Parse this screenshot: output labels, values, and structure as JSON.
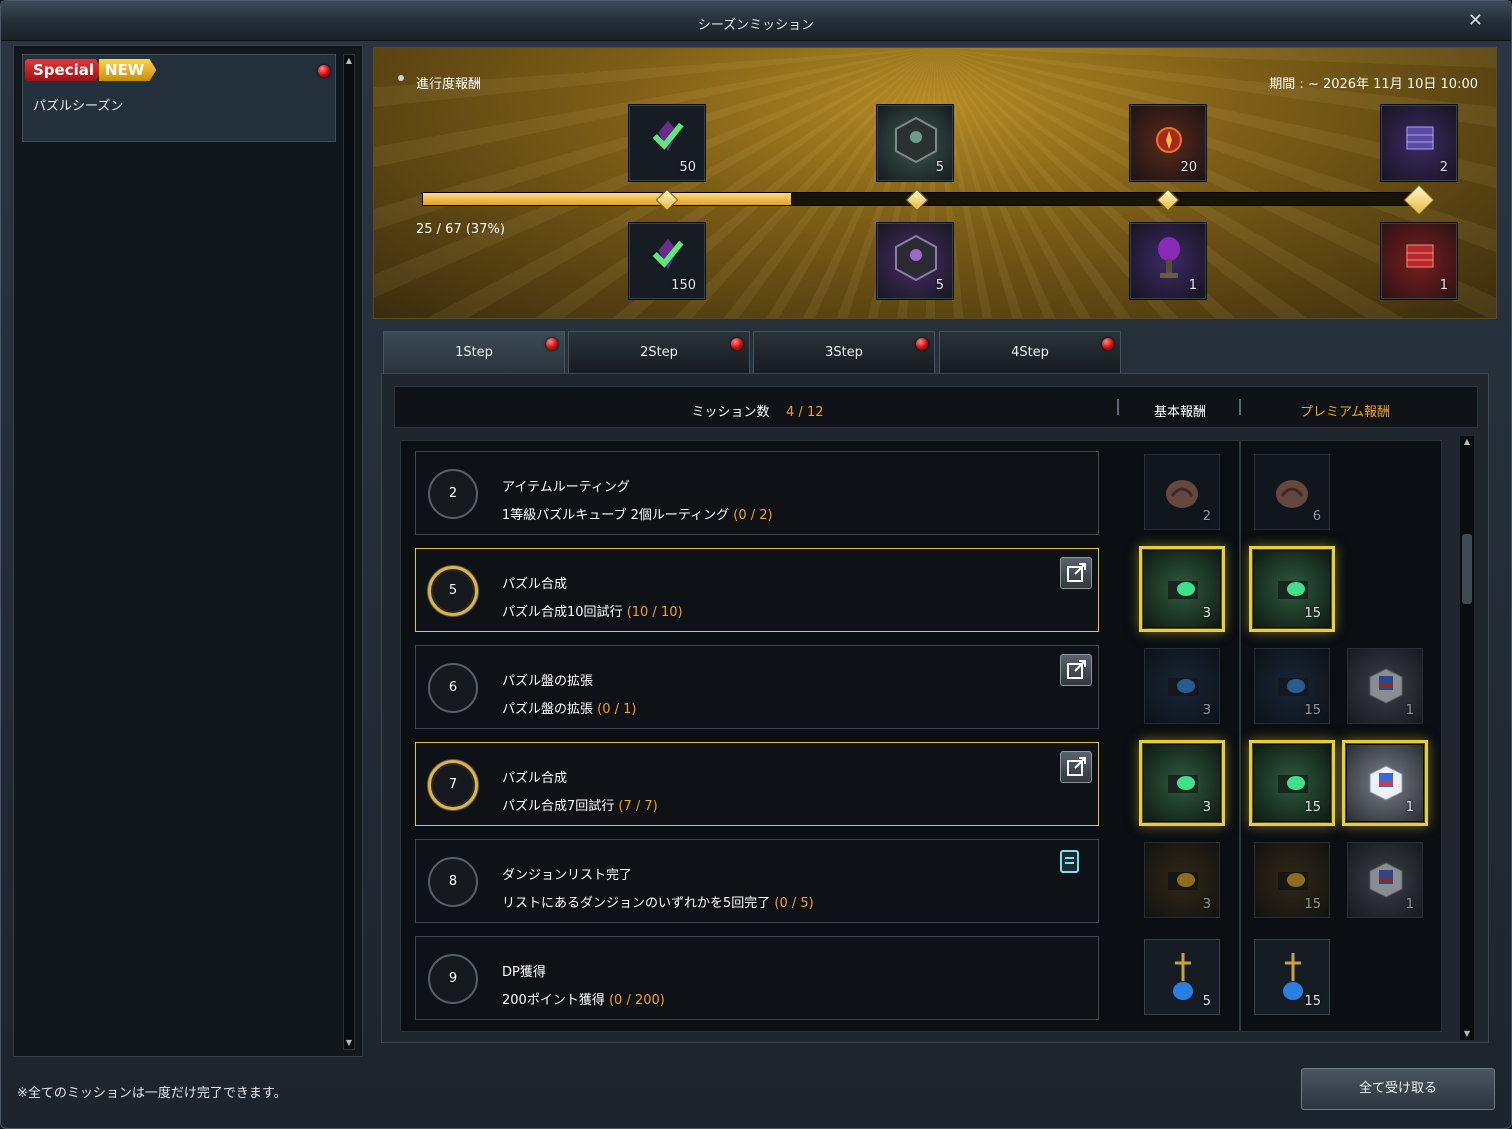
{
  "window": {
    "title": "シーズンミッション",
    "close_label": "✕"
  },
  "left": {
    "badge_special": "Special",
    "badge_new": "NEW",
    "season_name": "パズルシーズン",
    "scroll_up": "▲",
    "scroll_down": "▼"
  },
  "banner": {
    "title": "進行度報酬",
    "period": "期間 : ~ 2026年 11月 10日 10:00",
    "progress_text": "25 / 67 (37%)",
    "progress_fraction": 0.37,
    "top_rewards": [
      {
        "count": "50",
        "icon": "check-gem-icon"
      },
      {
        "count": "5",
        "icon": "puzzle-cube-icon"
      },
      {
        "count": "20",
        "icon": "red-crest-icon"
      },
      {
        "count": "2",
        "icon": "box-stack-icon"
      }
    ],
    "bottom_rewards": [
      {
        "count": "150",
        "icon": "check-gem-icon"
      },
      {
        "count": "5",
        "icon": "puzzle-cube-icon"
      },
      {
        "count": "1",
        "icon": "trophy-icon"
      },
      {
        "count": "1",
        "icon": "box-stack-icon"
      }
    ]
  },
  "tabs": [
    "1Step",
    "2Step",
    "3Step",
    "4Step"
  ],
  "header": {
    "mission_count_label": "ミッション数",
    "mission_count_value": "4 / 12",
    "basic_reward": "基本報酬",
    "premium_reward": "プレミアム報酬"
  },
  "missions": [
    {
      "number": "2",
      "title": "アイテムルーティング",
      "desc": "1等級パズルキューブ 2個ルーティング",
      "progress": "(0 / 2)",
      "basic": {
        "count": "2",
        "icon": "bag-icon"
      },
      "premium": {
        "count": "6",
        "icon": "bag-icon"
      }
    },
    {
      "number": "5",
      "title": "パズル合成",
      "desc": "パズル合成10回試行",
      "progress": "(10 / 10)",
      "basic": {
        "count": "3",
        "icon": "green-gem-icon"
      },
      "premium": {
        "count": "15",
        "icon": "green-gem-icon"
      }
    },
    {
      "number": "6",
      "title": "パズル盤の拡張",
      "desc": "パズル盤の拡張",
      "progress": "(0 / 1)",
      "basic": {
        "count": "3",
        "icon": "blue-gem-icon"
      },
      "premium": {
        "count": "15",
        "icon": "blue-gem-icon"
      },
      "extra": {
        "count": "1",
        "icon": "box-icon"
      }
    },
    {
      "number": "7",
      "title": "パズル合成",
      "desc": "パズル合成7回試行",
      "progress": "(7 / 7)",
      "basic": {
        "count": "3",
        "icon": "green-gem-icon"
      },
      "premium": {
        "count": "15",
        "icon": "green-gem-icon"
      },
      "extra": {
        "count": "1",
        "icon": "box-icon"
      }
    },
    {
      "number": "8",
      "title": "ダンジョンリスト完了",
      "desc": "リストにあるダンジョンのいずれかを5回完了",
      "progress": "(0 / 5)",
      "basic": {
        "count": "3",
        "icon": "gold-gem-icon"
      },
      "premium": {
        "count": "15",
        "icon": "gold-gem-icon"
      },
      "extra": {
        "count": "1",
        "icon": "box-icon"
      }
    },
    {
      "number": "9",
      "title": "DP獲得",
      "desc": "200ポイント獲得",
      "progress": "(0 / 200)",
      "basic": {
        "count": "5",
        "icon": "potion-icon"
      },
      "premium": {
        "count": "15",
        "icon": "potion-icon"
      }
    }
  ],
  "footer": {
    "note": "※全てのミッションは一度だけ完了できます。",
    "claim_all": "全て受け取る"
  },
  "colors": {
    "accent": "#f0a020",
    "complete_border": "#e5cf3b",
    "alert": "#d40b0b"
  }
}
